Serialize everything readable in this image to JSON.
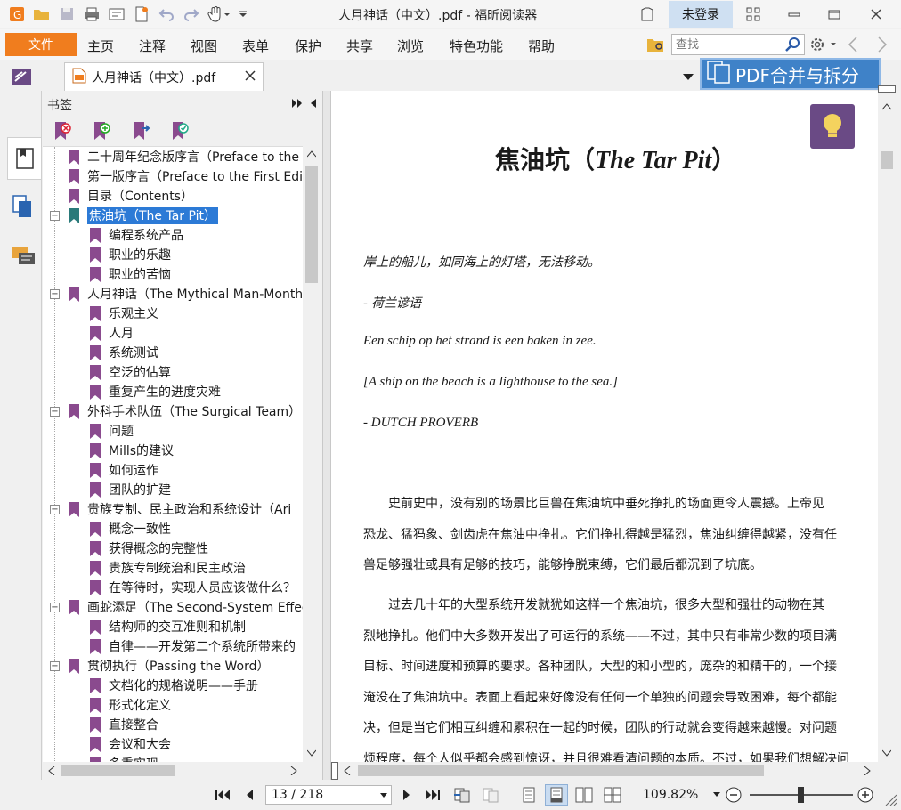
{
  "window": {
    "title": "人月神话（中文）.pdf - 福昕阅读器",
    "login_label": "未登录"
  },
  "menu": {
    "file": "文件",
    "items": [
      "主页",
      "注释",
      "视图",
      "表单",
      "保护",
      "共享",
      "浏览",
      "特色功能",
      "帮助"
    ],
    "search_placeholder": "查找"
  },
  "tab": {
    "label": "人月神话（中文）.pdf",
    "merge_banner": "PDF合并与拆分"
  },
  "bookmarks": {
    "header": "书签",
    "items": [
      {
        "label": "二十周年纪念版序言（Preface to the",
        "level": 0
      },
      {
        "label": "第一版序言（Preface to the First Editi",
        "level": 0
      },
      {
        "label": "目录（Contents）",
        "level": 0
      },
      {
        "label": "焦油坑（The Tar Pit）",
        "level": 0,
        "expanded": true,
        "selected": true
      },
      {
        "label": "编程系统产品",
        "level": 1
      },
      {
        "label": "职业的乐趣",
        "level": 1
      },
      {
        "label": "职业的苦恼",
        "level": 1
      },
      {
        "label": "人月神话（The Mythical Man-Month）",
        "level": 0,
        "expanded": true
      },
      {
        "label": "乐观主义",
        "level": 1
      },
      {
        "label": "人月",
        "level": 1
      },
      {
        "label": "系统测试",
        "level": 1
      },
      {
        "label": "空泛的估算",
        "level": 1
      },
      {
        "label": "重复产生的进度灾难",
        "level": 1
      },
      {
        "label": "外科手术队伍（The Surgical Team）",
        "level": 0,
        "expanded": true
      },
      {
        "label": "问题",
        "level": 1
      },
      {
        "label": "Mills的建议",
        "level": 1
      },
      {
        "label": "如何运作",
        "level": 1
      },
      {
        "label": "团队的扩建",
        "level": 1
      },
      {
        "label": "贵族专制、民主政治和系统设计（Ari",
        "level": 0,
        "expanded": true
      },
      {
        "label": "概念一致性",
        "level": 1
      },
      {
        "label": "获得概念的完整性",
        "level": 1
      },
      {
        "label": "贵族专制统治和民主政治",
        "level": 1
      },
      {
        "label": "在等待时，实现人员应该做什么？",
        "level": 1
      },
      {
        "label": "画蛇添足（The Second-System Effec",
        "level": 0,
        "expanded": true
      },
      {
        "label": "结构师的交互准则和机制",
        "level": 1
      },
      {
        "label": "自律——开发第二个系统所带来的",
        "level": 1
      },
      {
        "label": "贯彻执行（Passing the Word）",
        "level": 0,
        "expanded": true
      },
      {
        "label": "文档化的规格说明——手册",
        "level": 1
      },
      {
        "label": "形式化定义",
        "level": 1
      },
      {
        "label": "直接整合",
        "level": 1
      },
      {
        "label": "会议和大会",
        "level": 1
      },
      {
        "label": "多重实现",
        "level": 1
      }
    ]
  },
  "document": {
    "title_cn": "焦油坑（",
    "title_en": "The Tar Pit",
    "title_close": "）",
    "epigraph": [
      "岸上的船儿，如同海上的灯塔，无法移动。",
      "-     荷兰谚语",
      "Een schip op het strand is een baken in zee.",
      "[A ship on the beach is a lighthouse to the sea.]",
      "-     DUTCH PROVERB"
    ],
    "para1": [
      "　　史前史中，没有别的场景比巨兽在焦油坑中垂死挣扎的场面更令人震撼。上帝见",
      "恐龙、猛犸象、剑齿虎在焦油中挣扎。它们挣扎得越是猛烈，焦油纠缠得越紧，没有任",
      "兽足够强壮或具有足够的技巧，能够挣脱束缚，它们最后都沉到了坑底。"
    ],
    "para2": [
      "　　过去几十年的大型系统开发就犹如这样一个焦油坑，很多大型和强壮的动物在其",
      "烈地挣扎。他们中大多数开发出了可运行的系统——不过，其中只有非常少数的项目满",
      "目标、时间进度和预算的要求。各种团队，大型的和小型的，庞杂的和精干的，一个接",
      "淹没在了焦油坑中。表面上看起来好像没有任何一个单独的问题会导致困难，每个都能",
      "决，但是当它们相互纠缠和累积在一起的时候，团队的行动就会变得越来越慢。对问题",
      "烦程度，每个人似乎都会感到惊讶，并且很难看清问题的本质。不过，如果我们想解决问"
    ]
  },
  "status": {
    "page": "13 / 218",
    "zoom": "109.82%"
  },
  "colors": {
    "accent_orange": "#f07d1e",
    "selection_blue": "#2c7ad6",
    "bookmark_purple": "#8a4a8e",
    "banner_blue": "#3f82c8"
  }
}
